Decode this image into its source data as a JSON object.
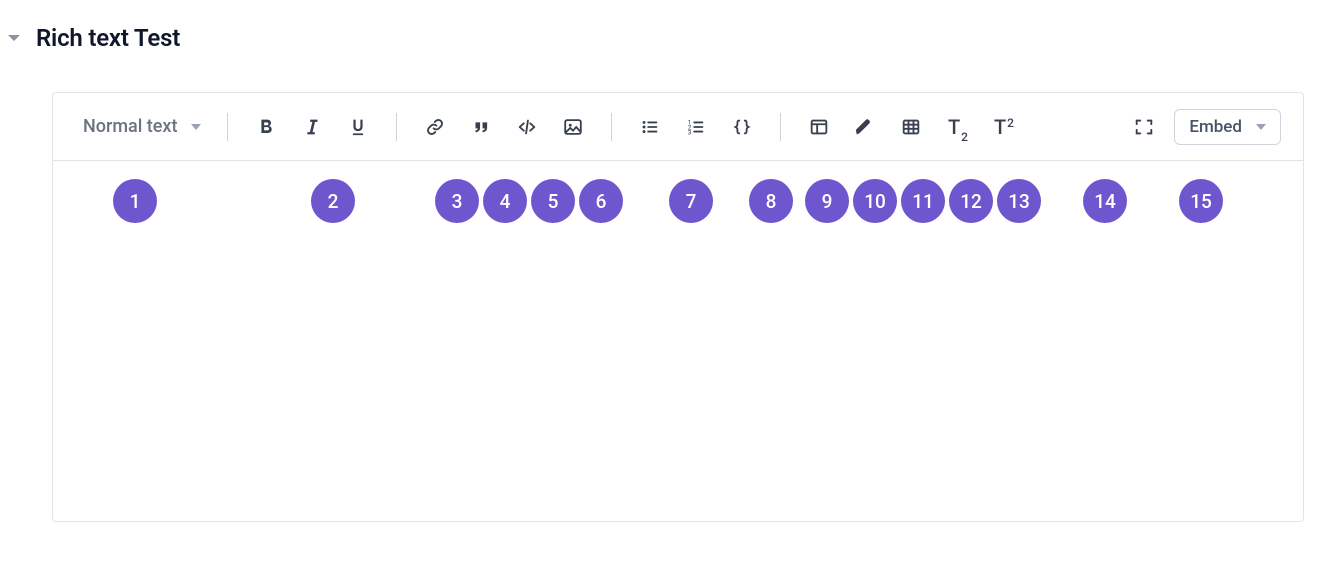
{
  "header": {
    "title": "Rich text Test"
  },
  "toolbar": {
    "text_style_label": "Normal text",
    "embed_label": "Embed"
  },
  "pills": [
    {
      "n": "1",
      "ml": 38,
      "mr": 0
    },
    {
      "n": "2",
      "ml": 154,
      "mr": 0
    },
    {
      "n": "3",
      "ml": 80,
      "mr": 0
    },
    {
      "n": "4",
      "ml": 4,
      "mr": 0
    },
    {
      "n": "5",
      "ml": 4,
      "mr": 0
    },
    {
      "n": "6",
      "ml": 4,
      "mr": 0
    },
    {
      "n": "7",
      "ml": 46,
      "mr": 0
    },
    {
      "n": "8",
      "ml": 36,
      "mr": 0
    },
    {
      "n": "9",
      "ml": 12,
      "mr": 0
    },
    {
      "n": "10",
      "ml": 4,
      "mr": 0
    },
    {
      "n": "11",
      "ml": 4,
      "mr": 0
    },
    {
      "n": "12",
      "ml": 4,
      "mr": 0
    },
    {
      "n": "13",
      "ml": 4,
      "mr": 0
    },
    {
      "n": "14",
      "ml": 42,
      "mr": 0
    },
    {
      "n": "15",
      "ml": 52,
      "mr": 0
    }
  ]
}
